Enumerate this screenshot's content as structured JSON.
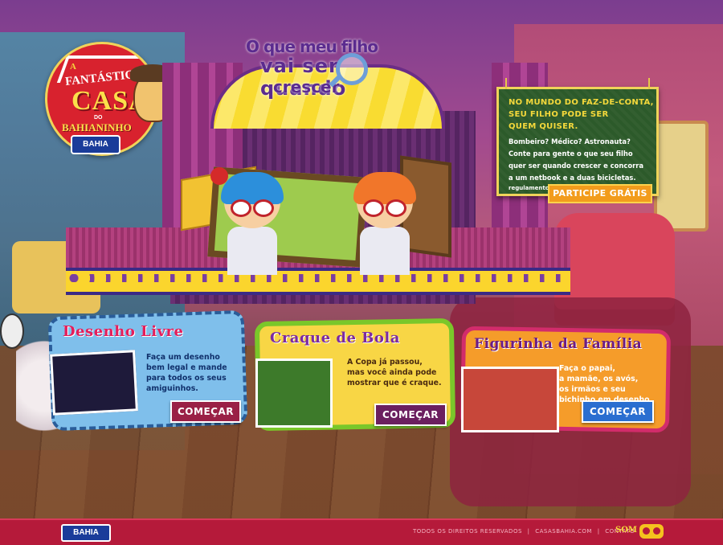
{
  "logo": {
    "line1": "A",
    "line2": "FANTÁSTICA",
    "line3": "CASA",
    "line4": "DO",
    "line5": "BAHIANINHO",
    "badge": "BAHIA"
  },
  "stage": {
    "title_line1": "O que meu filho",
    "title_line2": "vai ser quando",
    "title_line3": "crescer"
  },
  "info": {
    "heading": [
      "NO MUNDO DO FAZ-DE-CONTA,",
      "SEU FILHO PODE SER",
      "QUEM QUISER."
    ],
    "body": [
      "Bombeiro? Médico? Astronauta?",
      "Conte para gente o que seu filho",
      "quer ser quando crescer e concorra",
      "a um netbook e a duas bicicletas."
    ],
    "regulation_link": "regulamento",
    "cta_label": "PARTICIPE GRÁTIS"
  },
  "cards": [
    {
      "title": "Desenho Livre",
      "description": [
        "Faça um desenho",
        "bem legal e mande",
        "para todos os seus",
        "amiguinhos."
      ],
      "button": "COMEÇAR"
    },
    {
      "title": "Craque de Bola",
      "description": [
        "A Copa já passou,",
        "mas você ainda pode",
        "mostrar que é craque."
      ],
      "button": "COMEÇAR"
    },
    {
      "title": "Figurinha da Família",
      "description": [
        "Faça o papai,",
        "a mamãe, os avós,",
        "os irmãos e seu",
        "bichinho em desenho."
      ],
      "button": "COMEÇAR"
    }
  ],
  "footer": {
    "badge": "BAHIA",
    "rights": "TODOS OS DIREITOS RESERVADOS",
    "site": "CASASBAHIA.COM",
    "contact": "CONTATO",
    "separator": "|",
    "sound_label": "SOM"
  },
  "colors": {
    "footer_bg": "#b51a3a",
    "cta_orange": "#f29c1c",
    "panel_green": "#2c5a2a",
    "accent_yellow": "#f5d93b"
  }
}
